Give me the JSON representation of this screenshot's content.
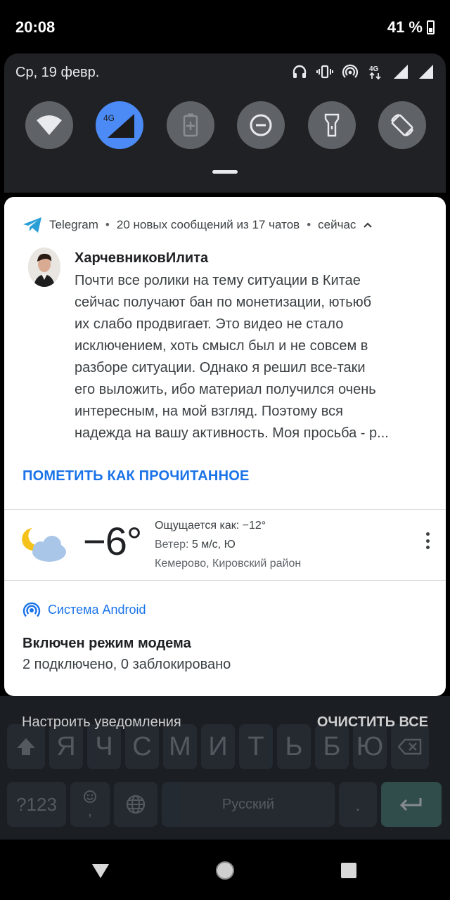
{
  "status_bar": {
    "time": "20:08",
    "battery": "41 %"
  },
  "quick_settings": {
    "date": "Ср, 19 февр.",
    "status_icons": [
      "headphones-icon",
      "vibrate-icon",
      "hotspot-icon",
      "4g-data-icon",
      "signal-icon",
      "signal-icon"
    ],
    "tiles": [
      {
        "name": "wifi",
        "active": false
      },
      {
        "name": "mobile-data",
        "label": "4G",
        "active": true
      },
      {
        "name": "battery-saver",
        "active": false
      },
      {
        "name": "do-not-disturb",
        "active": false
      },
      {
        "name": "flashlight",
        "active": false
      },
      {
        "name": "auto-rotate",
        "active": false
      }
    ]
  },
  "telegram": {
    "app": "Telegram",
    "summary": "20 новых сообщений из 17 чатов",
    "time": "сейчас",
    "sender": "ХарчевниковИлита",
    "message_lines": [
      "Почти все ролики на тему ситуации в Китае",
      "сейчас получают бан по монетизации, ютьюб",
      "их слабо продвигает. Это видео не стало",
      "исключением, хоть смысл был и не совсем в",
      "разборе ситуации. Однако я решил все-таки",
      "его выложить, ибо материал получился очень",
      "интересным, на мой взгляд. Поэтому вся",
      "надежда на вашу активность. Моя просьба - р..."
    ],
    "action": "ПОМЕТИТЬ КАК ПРОЧИТАННОЕ"
  },
  "weather": {
    "temperature": "−6°",
    "feels_like_label": "Ощущается как:",
    "feels_like_value": "−12°",
    "wind_label": "Ветер:",
    "wind_value": "5 м/с, Ю",
    "location": "Кемерово, Кировский район"
  },
  "android_system": {
    "app": "Система Android",
    "title": "Включен режим модема",
    "subtitle": "2 подключено, 0 заблокировано"
  },
  "footer": {
    "settings_link": "Настроить уведомления",
    "clear_all": "ОЧИСТИТЬ ВСЕ"
  },
  "keyboard": {
    "row_letters": [
      "Я",
      "Ч",
      "С",
      "М",
      "И",
      "Т",
      "Ь",
      "Б",
      "Ю"
    ],
    "symbols_key": "?123",
    "space_label": "Русский",
    "period_key": ".",
    "comma_key": ","
  },
  "colors": {
    "accent": "#1a73e8",
    "tile_active": "#4c8bf5",
    "tile_inactive": "#5f6368"
  }
}
